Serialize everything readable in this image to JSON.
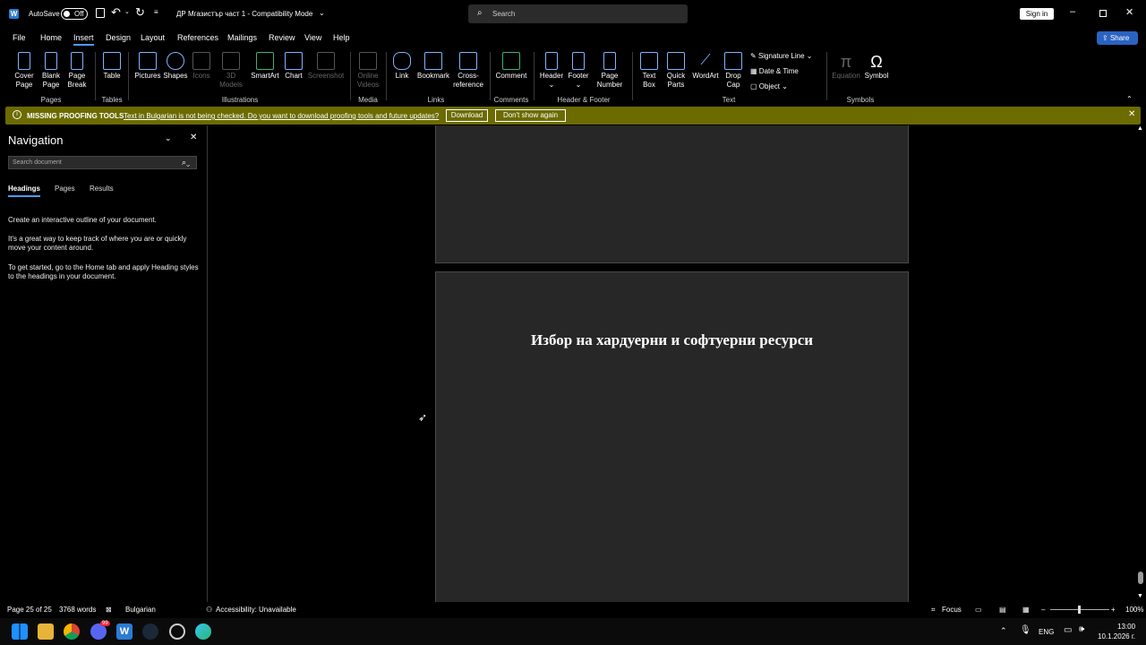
{
  "titlebar": {
    "autosave_label": "AutoSave",
    "autosave_state": "Off",
    "doc_title": "ДР Мгазистър част 1 - Compatibility Mode",
    "search_placeholder": "Search",
    "signin_label": "Sign in"
  },
  "menu": {
    "items": [
      "File",
      "Home",
      "Insert",
      "Design",
      "Layout",
      "References",
      "Mailings",
      "Review",
      "View",
      "Help"
    ],
    "active": "Insert",
    "share_label": "Share"
  },
  "ribbon": {
    "cover_page": "Cover Page",
    "blank_page": "Blank Page",
    "page_break": "Page Break",
    "table": "Table",
    "pictures": "Pictures",
    "shapes": "Shapes",
    "icons": "Icons",
    "models3d": "3D Models",
    "smartart": "SmartArt",
    "chart": "Chart",
    "screenshot": "Screenshot",
    "online_videos": "Online Videos",
    "link": "Link",
    "bookmark": "Bookmark",
    "crossref": "Cross-reference",
    "comment": "Comment",
    "header": "Header",
    "footer": "Footer",
    "page_number": "Page Number",
    "text_box": "Text Box",
    "quick_parts": "Quick Parts",
    "wordart": "WordArt",
    "drop_cap": "Drop Cap",
    "signature_line": "Signature Line",
    "date_time": "Date & Time",
    "object": "Object",
    "equation": "Equation",
    "symbol": "Symbol",
    "groups": {
      "pages": "Pages",
      "tables": "Tables",
      "illustrations": "Illustrations",
      "media": "Media",
      "links": "Links",
      "comments": "Comments",
      "header_footer": "Header & Footer",
      "text": "Text",
      "symbols": "Symbols"
    }
  },
  "infobar": {
    "title": "MISSING PROOFING TOOLS",
    "message": "Text in Bulgarian is not being checked. Do you want to download proofing tools and future updates?",
    "download_label": "Download",
    "dont_show_label": "Don't show again"
  },
  "navigation": {
    "title": "Navigation",
    "search_placeholder": "Search document",
    "tabs": [
      "Headings",
      "Pages",
      "Results"
    ],
    "active_tab": "Headings",
    "p1": "Create an interactive outline of your document.",
    "p2": "It's a great way to keep track of where you are or quickly move your content around.",
    "p3": "To get started, go to the Home tab and apply Heading styles to the headings in your document."
  },
  "document": {
    "heading": "Избор на хардуерни и софтуерни ресурси"
  },
  "statusbar": {
    "page": "Page 25 of 25",
    "words": "3768 words",
    "language": "Bulgarian",
    "accessibility": "Accessibility: Unavailable",
    "focus": "Focus",
    "zoom": "100%"
  },
  "taskbar": {
    "lang": "ENG",
    "time": "13:00",
    "date": "10.1.2026 г.",
    "badge": "99"
  },
  "colors": {
    "accent": "#4c9bff",
    "infobar": "#6b6b00",
    "page": "#272727"
  }
}
